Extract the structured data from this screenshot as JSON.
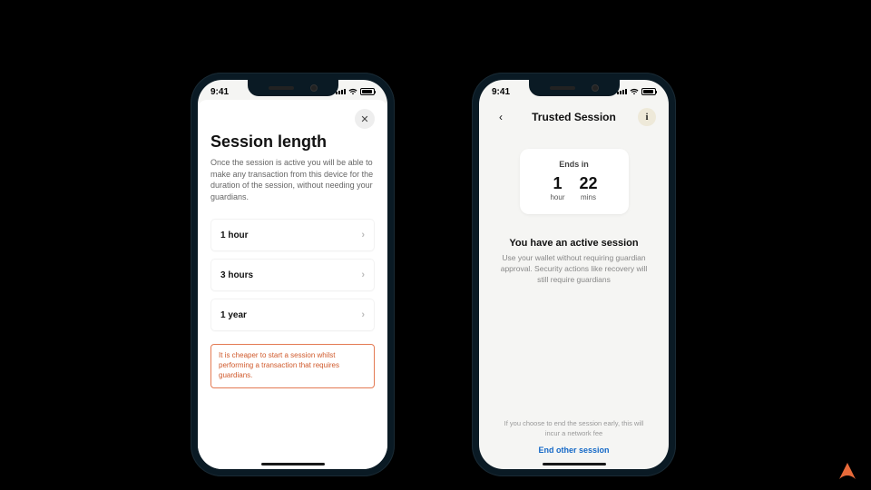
{
  "status": {
    "time": "9:41"
  },
  "left": {
    "title": "Session length",
    "description": "Once the session is active you will be able to make any transaction from this device for the duration of the session, without needing your guardians.",
    "options": [
      {
        "label": "1 hour"
      },
      {
        "label": "3 hours"
      },
      {
        "label": "1 year"
      }
    ],
    "note": "It is cheaper to start a session whilst performing a transaction that requires guardians."
  },
  "right": {
    "nav_title": "Trusted Session",
    "timer": {
      "label": "Ends in",
      "hours_value": "1",
      "hours_unit": "hour",
      "mins_value": "22",
      "mins_unit": "mins"
    },
    "active_heading": "You have an active session",
    "active_description": "Use your wallet without requiring guardian approval. Security actions like recovery will still require guardians",
    "end_note": "If you choose to end the session early, this will incur a network fee",
    "end_link": "End other session"
  }
}
